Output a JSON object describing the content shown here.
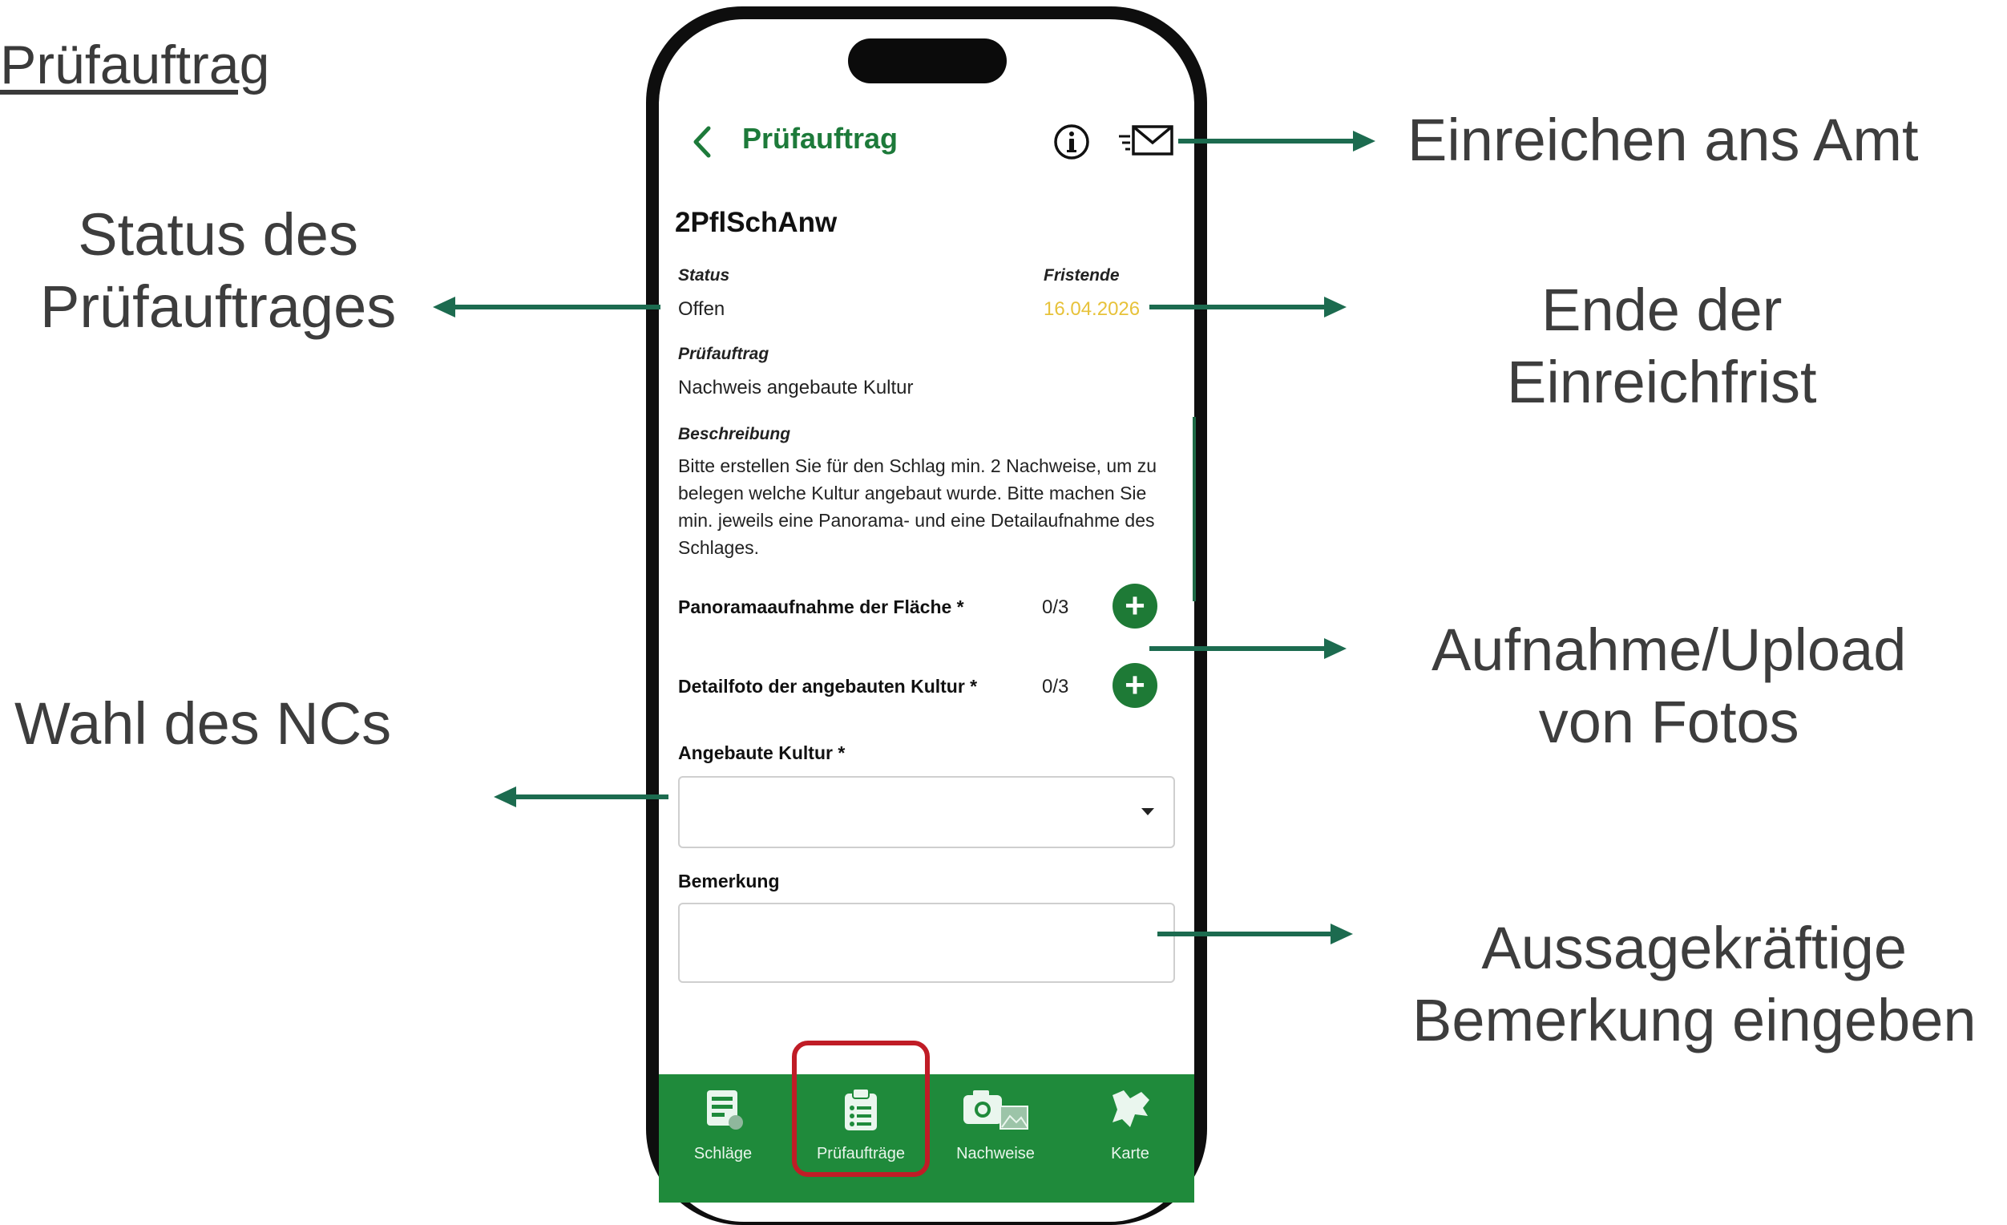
{
  "slide": {
    "title": "Prüfauftrag",
    "callouts": {
      "status_l1": "Status des",
      "status_l2": "Prüfauftrages",
      "nc": "Wahl des NCs",
      "submit": "Einreichen ans Amt",
      "deadline_l1": "Ende der",
      "deadline_l2": "Einreichfrist",
      "upload_l1": "Aufnahme/Upload",
      "upload_l2": "von Fotos",
      "remark_l1": "Aussagekräftige",
      "remark_l2": "Bemerkung eingeben"
    }
  },
  "app": {
    "header": {
      "title": "Prüfauftrag",
      "back_icon": "chevron-left-icon",
      "info_icon": "info-circle-icon",
      "submit_icon": "send-mail-icon"
    },
    "record": {
      "name": "2PflSchAnw",
      "status_label": "Status",
      "status_value": "Offen",
      "deadline_label": "Fristende",
      "deadline_value": "16.04.2026",
      "task_label": "Prüfauftrag",
      "task_value": "Nachweis angebaute Kultur",
      "description_label": "Beschreibung",
      "description_text": "Bitte erstellen Sie für den Schlag min. 2 Nachweise, um zu belegen welche Kultur angebaut wurde. Bitte machen Sie min. jeweils eine Panorama- und eine Detailaufnahme des Schlages."
    },
    "photos": [
      {
        "label": "Panoramaaufnahme der Fläche *",
        "count": "0/3"
      },
      {
        "label": "Detailfoto der angebauten Kultur *",
        "count": "0/3"
      }
    ],
    "crop_field": {
      "label": "Angebaute Kultur *",
      "value": ""
    },
    "remark_field": {
      "label": "Bemerkung",
      "value": ""
    },
    "nav": [
      {
        "label": "Schläge",
        "icon": "fields-list-icon"
      },
      {
        "label": "Prüfaufträge",
        "icon": "clipboard-icon"
      },
      {
        "label": "Nachweise",
        "icon": "camera-gallery-icon"
      },
      {
        "label": "Karte",
        "icon": "map-region-icon"
      }
    ],
    "colors": {
      "brand_green": "#1f8a3b",
      "deadline_yellow": "#e7c23a",
      "arrow_green": "#1c6b4f",
      "highlight_red": "#c01c26"
    }
  }
}
